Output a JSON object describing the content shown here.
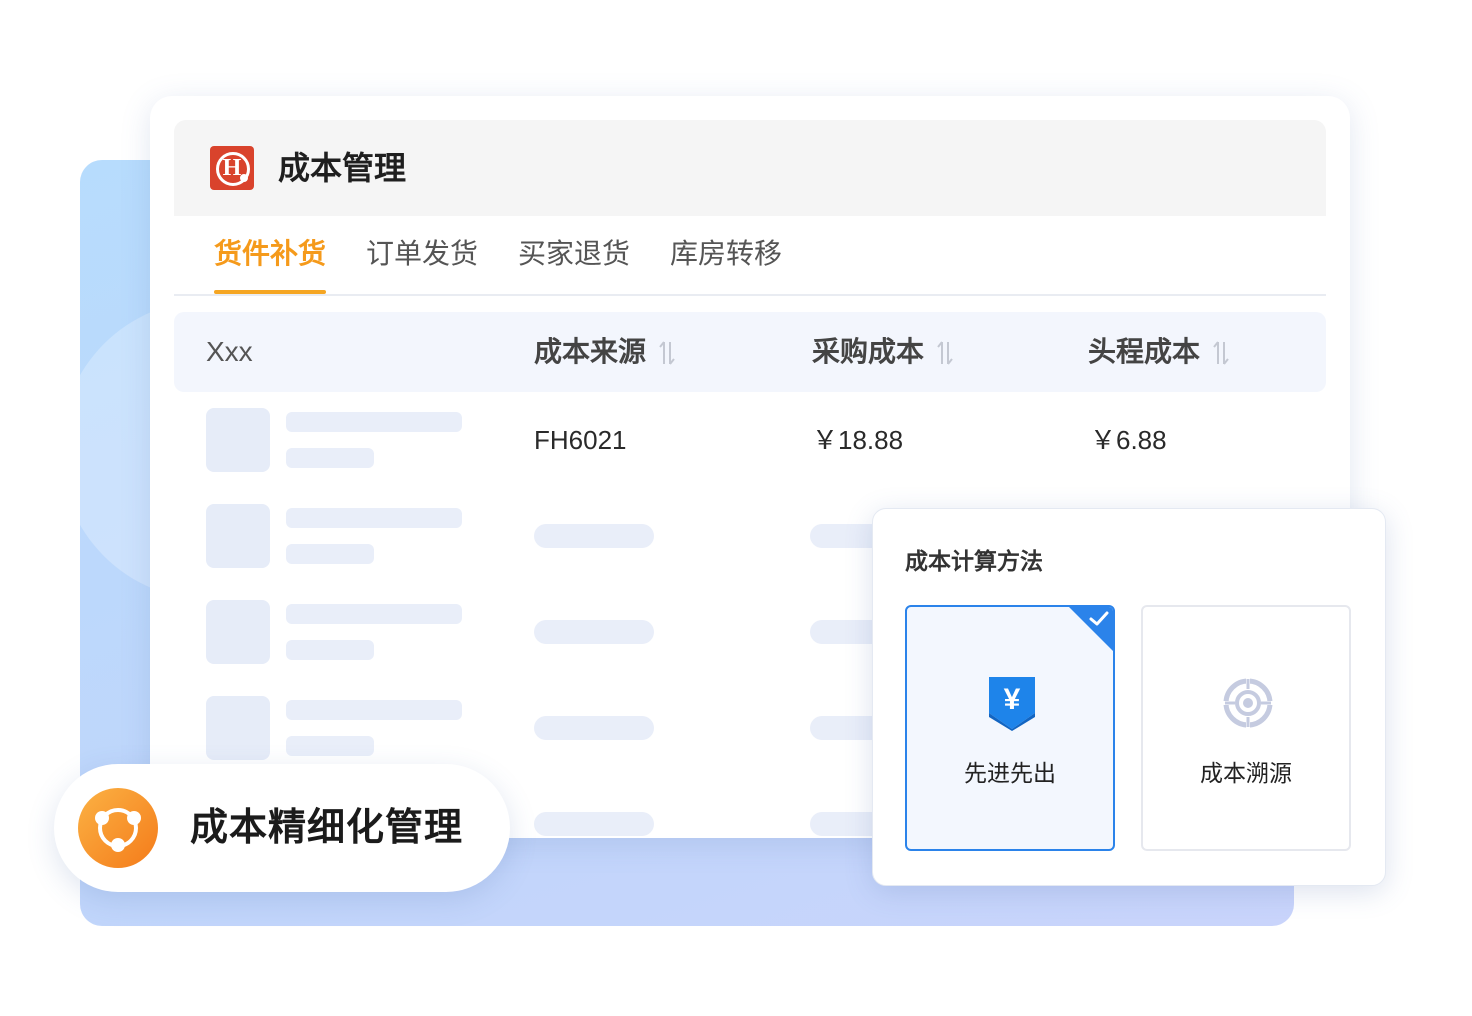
{
  "header": {
    "title": "成本管理"
  },
  "tabs": [
    {
      "label": "货件补货",
      "active": true
    },
    {
      "label": "订单发货",
      "active": false
    },
    {
      "label": "买家退货",
      "active": false
    },
    {
      "label": "库房转移",
      "active": false
    }
  ],
  "table": {
    "columns": [
      "Xxx",
      "成本来源",
      "采购成本",
      "头程成本"
    ],
    "rows": [
      {
        "source": "FH6021",
        "purchase_cost": "￥18.88",
        "shipping_cost": "￥6.88"
      }
    ]
  },
  "popup": {
    "title": "成本计算方法",
    "options": [
      {
        "label": "先进先出",
        "icon": "yen-icon",
        "selected": true
      },
      {
        "label": "成本溯源",
        "icon": "target-icon",
        "selected": false
      }
    ]
  },
  "badge": {
    "text": "成本精细化管理",
    "icon": "nodes-icon"
  },
  "colors": {
    "accent": "#f5a623",
    "primary_blue": "#2b83ea",
    "logo_red": "#d9432c"
  }
}
